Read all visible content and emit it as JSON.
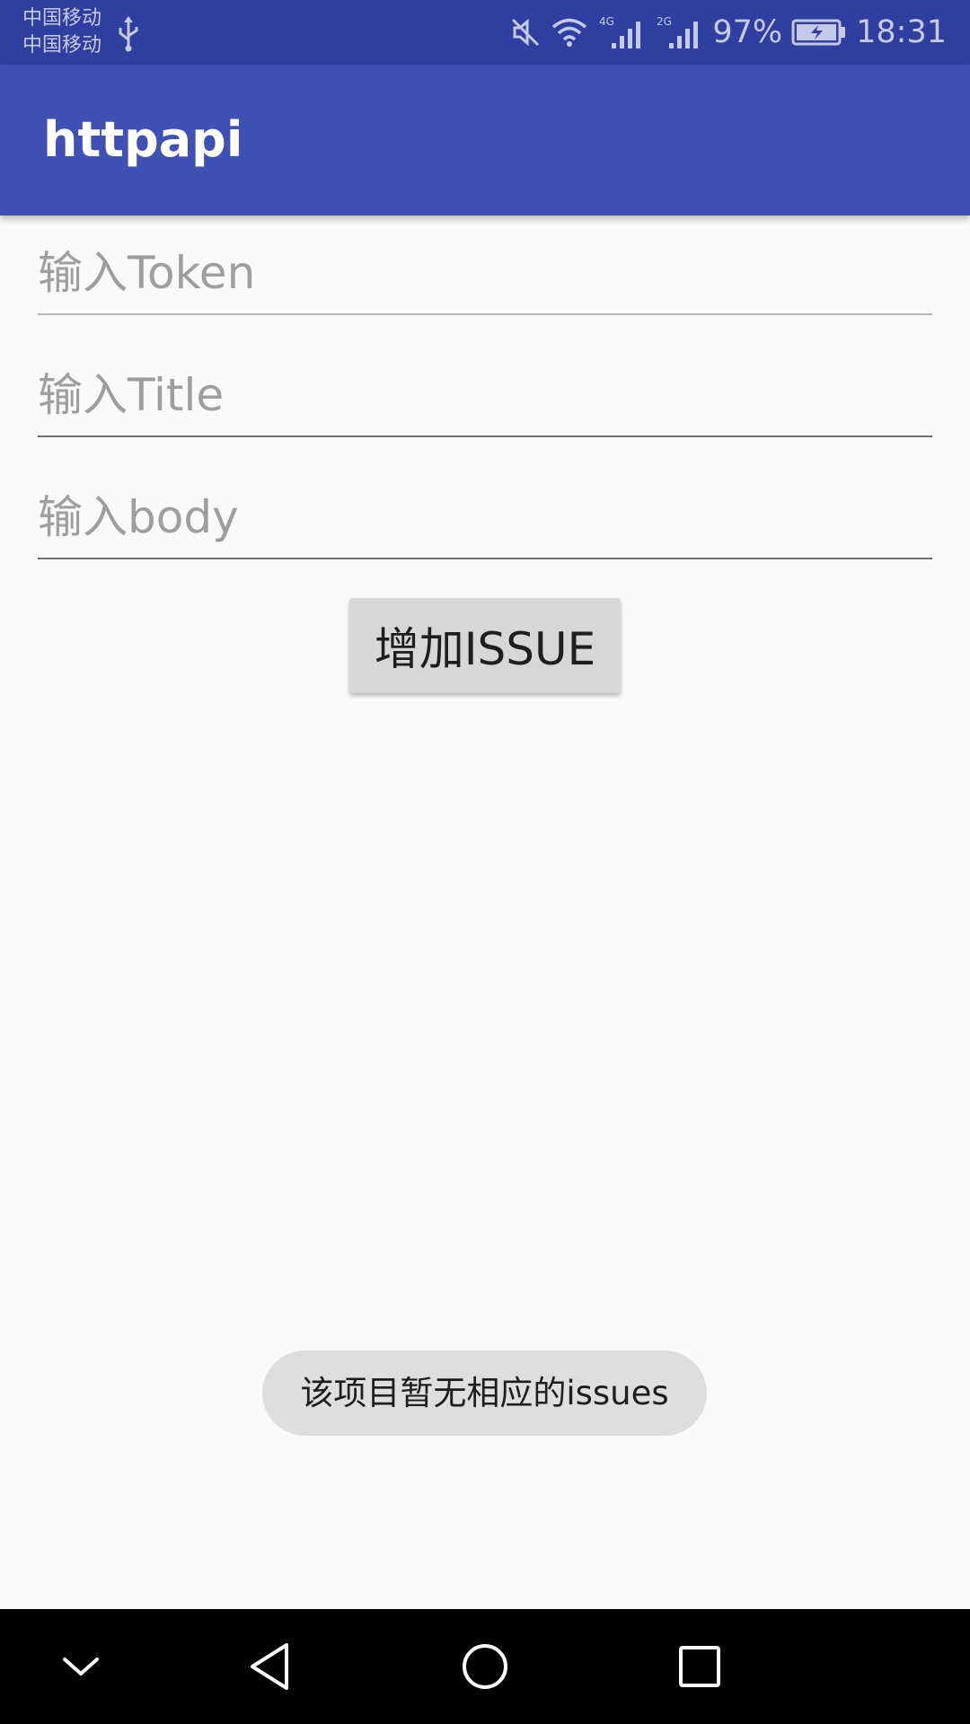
{
  "status_bar": {
    "carrier_1": "中国移动",
    "carrier_2": "中国移动",
    "network_1": "4G",
    "network_2": "2G",
    "battery": "97%",
    "time": "18:31",
    "icons": [
      "usb-icon",
      "mute-icon",
      "wifi-icon",
      "signal-icon",
      "signal-icon",
      "battery-charging-icon"
    ]
  },
  "app_bar": {
    "title": "httpapi",
    "color": "#3f51b5",
    "status_color": "#303f9f"
  },
  "form": {
    "token_placeholder": "输入Token",
    "title_placeholder": "输入Title",
    "body_placeholder": "输入body",
    "add_button_label": "增加ISSUE"
  },
  "toast": {
    "message": "该项目暂无相应的issues"
  },
  "nav_bar": {
    "icons": [
      "collapse-icon",
      "back-icon",
      "home-icon",
      "recent-apps-icon"
    ]
  }
}
